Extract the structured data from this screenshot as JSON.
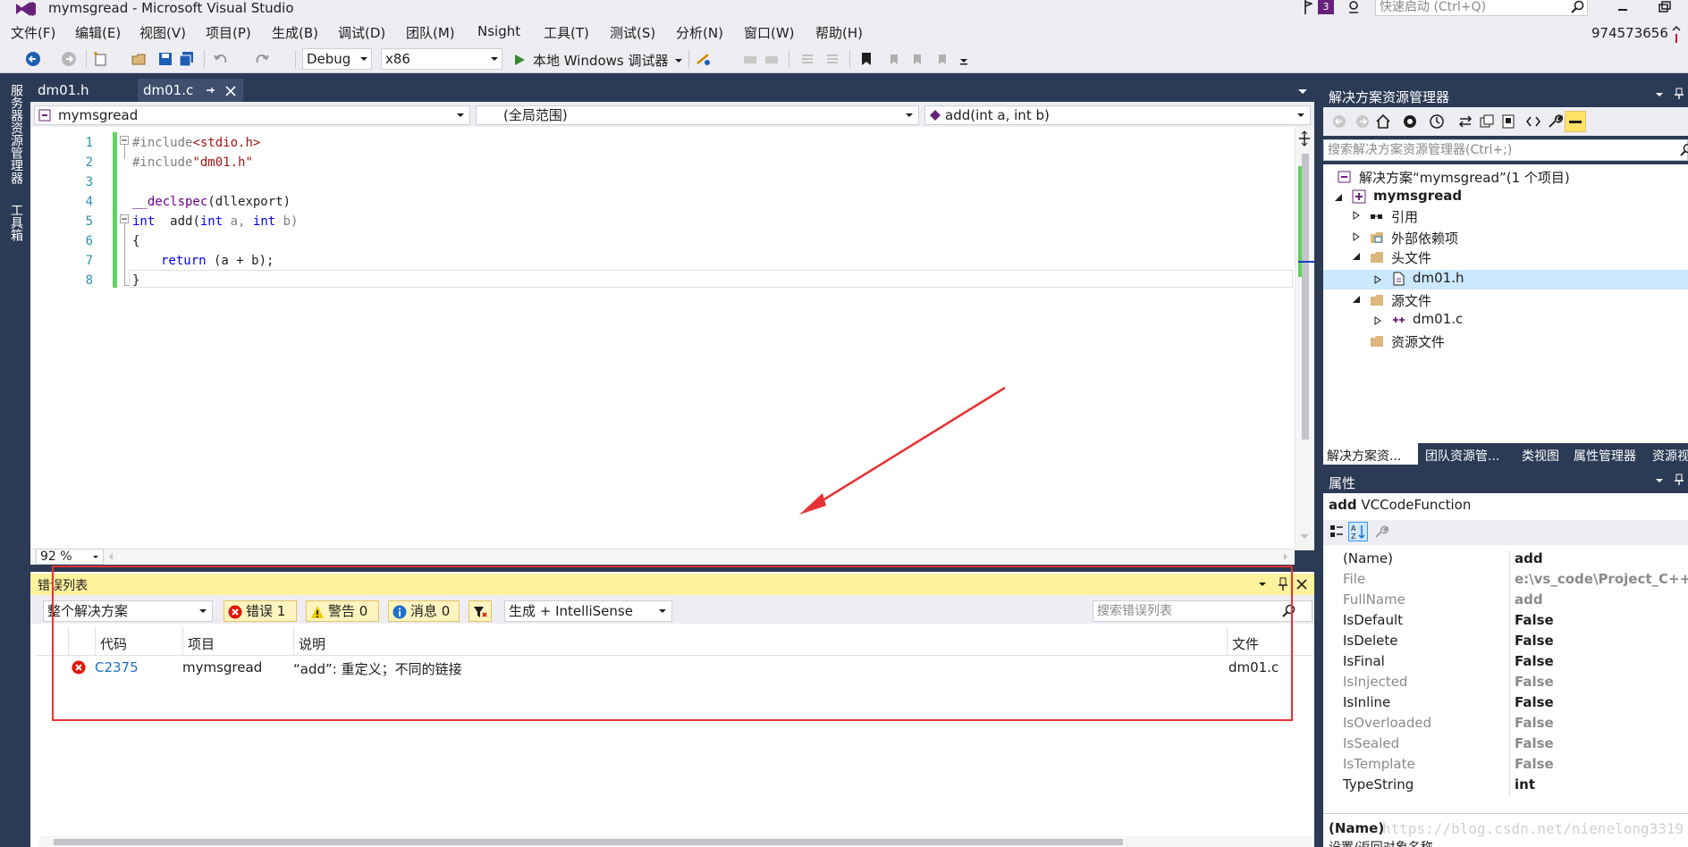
{
  "window": {
    "title": "mymsgread - Microsoft Visual Studio",
    "notification_count": "3",
    "quick_launch_placeholder": "快速启动 (Ctrl+Q)",
    "user": "974573656"
  },
  "menu": [
    "文件(F)",
    "编辑(E)",
    "视图(V)",
    "项目(P)",
    "生成(B)",
    "调试(D)",
    "团队(M)",
    "Nsight",
    "工具(T)",
    "测试(S)",
    "分析(N)",
    "窗口(W)",
    "帮助(H)"
  ],
  "toolbar": {
    "config": "Debug",
    "platform": "x86",
    "run_label": "本地 Windows 调试器"
  },
  "side_tabs": [
    "服务器资源管理器",
    "工具箱"
  ],
  "doc_tabs": [
    "dm01.h",
    "dm01.c"
  ],
  "navbar": {
    "project": "mymsgread",
    "scope": "(全局范围)",
    "member": "add(int a, int b)"
  },
  "editor": {
    "zoom": "92 %",
    "line_numbers": [
      "1",
      "2",
      "3",
      "4",
      "5",
      "6",
      "7",
      "8"
    ],
    "code": {
      "l1_pp": "#include",
      "l1_str": "<stdio.h>",
      "l2_pp": "#include",
      "l2_str": "\"dm01.h\"",
      "l4_mac": "__declspec",
      "l4_rest": "(dllexport)",
      "l5_kw1": "int",
      "l5_fn": "  add(",
      "l5_kw2": "int",
      "l5_a": " a, ",
      "l5_kw3": "int",
      "l5_b": " b)",
      "l6": "{",
      "l7_kw": "return",
      "l7_rest": " (a + b);",
      "l8": "}"
    }
  },
  "error_list": {
    "title": "错误列表",
    "scope_filter": "整个解决方案",
    "errors_btn": "错误 1",
    "warnings_btn": "警告 0",
    "messages_btn": "消息 0",
    "build_filter": "生成 + IntelliSense",
    "search_placeholder": "搜索错误列表",
    "columns": {
      "code": "代码",
      "project": "项目",
      "description": "说明",
      "file": "文件"
    },
    "rows": [
      {
        "code": "C2375",
        "project": "mymsgread",
        "description": "“add”: 重定义；不同的链接",
        "file": "dm01.c"
      }
    ]
  },
  "solution_explorer": {
    "title": "解决方案资源管理器",
    "search_placeholder": "搜索解决方案资源管理器(Ctrl+;)",
    "tree": {
      "solution": "解决方案“mymsgread”(1 个项目)",
      "project": "mymsgread",
      "references": "引用",
      "external_deps": "外部依赖项",
      "headers": "头文件",
      "header_file": "dm01.h",
      "sources": "源文件",
      "source_file": "dm01.c",
      "resources": "资源文件"
    },
    "bottom_tabs": [
      "解决方案资...",
      "团队资源管...",
      "类视图",
      "属性管理器",
      "资源视"
    ]
  },
  "properties": {
    "title": "属性",
    "object_name": "add",
    "object_type": "VCCodeFunction",
    "rows": [
      {
        "name": "(Name)",
        "value": "add"
      },
      {
        "name": "File",
        "value": "e:\\vs_code\\Project_C++\\m"
      },
      {
        "name": "FullName",
        "value": "add"
      },
      {
        "name": "IsDefault",
        "value": "False"
      },
      {
        "name": "IsDelete",
        "value": "False"
      },
      {
        "name": "IsFinal",
        "value": "False"
      },
      {
        "name": "IsInjected",
        "value": "False"
      },
      {
        "name": "IsInline",
        "value": "False"
      },
      {
        "name": "IsOverloaded",
        "value": "False"
      },
      {
        "name": "IsSealed",
        "value": "False"
      },
      {
        "name": "IsTemplate",
        "value": "False"
      },
      {
        "name": "TypeString",
        "value": "int"
      }
    ],
    "desc_title": "(Name)",
    "desc_text": "设置/返回对象名称。",
    "watermark": "https://blog.csdn.net/nienelong3319"
  },
  "colors": {
    "accent": "#68217a",
    "frame": "#2b3a55",
    "error_header": "#fff29d",
    "annotation": "#e83232"
  }
}
